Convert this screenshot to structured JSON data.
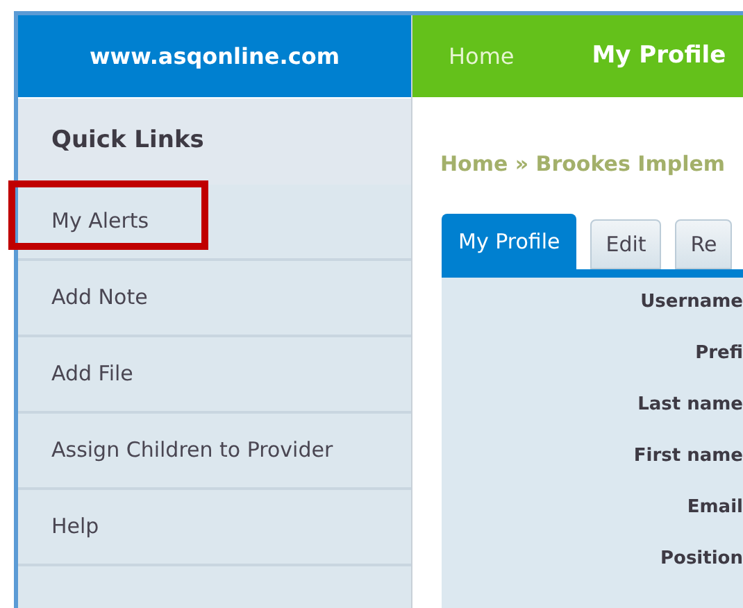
{
  "site": {
    "title": "www.asqonline.com"
  },
  "nav": [
    {
      "label": "Home",
      "selected": false
    },
    {
      "label": "My Profile",
      "selected": true
    }
  ],
  "sidebar": {
    "title": "Quick Links",
    "items": [
      {
        "label": "My Alerts",
        "highlighted": true
      },
      {
        "label": "Add Note",
        "highlighted": false
      },
      {
        "label": "Add File",
        "highlighted": false
      },
      {
        "label": "Assign Children to Provider",
        "highlighted": false
      },
      {
        "label": "Help",
        "highlighted": false
      }
    ]
  },
  "breadcrumb": "Home » Brookes Implem",
  "tabs": [
    {
      "label": "My Profile",
      "selected": true
    },
    {
      "label": "Edit",
      "selected": false
    },
    {
      "label": "Re",
      "selected": false
    }
  ],
  "profile_fields": [
    "Username",
    "Prefi",
    "Last name",
    "First name",
    "Email",
    "Position"
  ]
}
